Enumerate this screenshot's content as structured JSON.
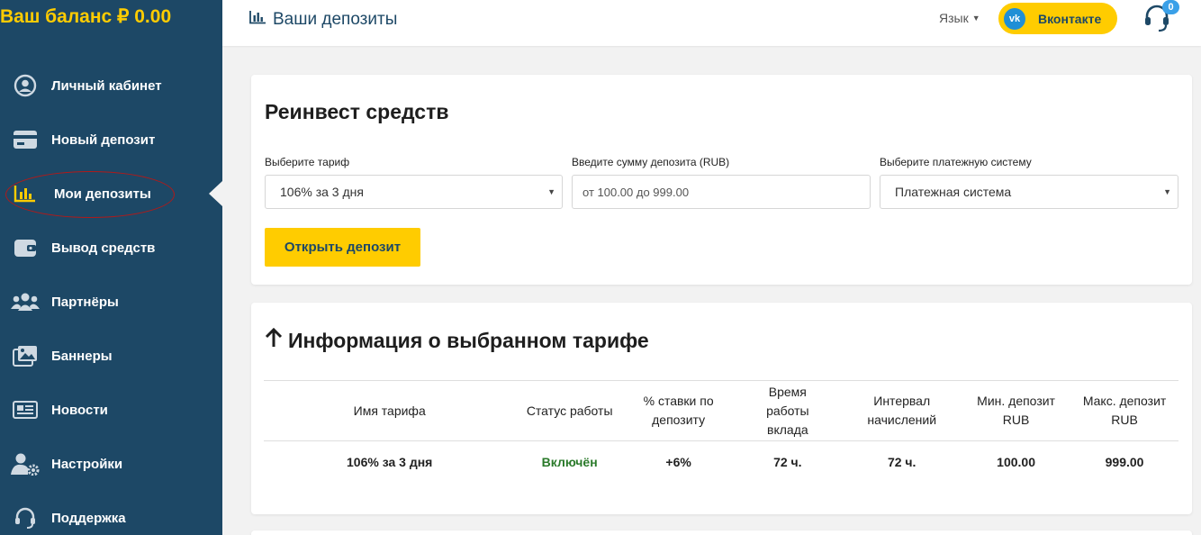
{
  "sidebar": {
    "balance": "Ваш баланс ₽ 0.00",
    "items": [
      {
        "label": "Личный кабинет",
        "icon": "user-circle-icon"
      },
      {
        "label": "Новый депозит",
        "icon": "credit-card-icon"
      },
      {
        "label": "Мои депозиты",
        "icon": "bar-chart-icon",
        "active": true
      },
      {
        "label": "Вывод средств",
        "icon": "wallet-icon"
      },
      {
        "label": "Партнёры",
        "icon": "users-icon"
      },
      {
        "label": "Баннеры",
        "icon": "images-icon"
      },
      {
        "label": "Новости",
        "icon": "newspaper-icon"
      },
      {
        "label": "Настройки",
        "icon": "user-cog-icon"
      },
      {
        "label": "Поддержка",
        "icon": "headset-icon"
      }
    ]
  },
  "header": {
    "title": "Ваши депозиты",
    "language_label": "Язык",
    "vk_label": "Вконтакте",
    "support_badge": "0"
  },
  "reinvest": {
    "title": "Реинвест средств",
    "tariff_label": "Выберите тариф",
    "tariff_value": "106% за 3 дня",
    "amount_label": "Введите сумму депозита (RUB)",
    "amount_placeholder": "от 100.00 до 999.00",
    "payment_label": "Выберите платежную систему",
    "payment_value": "Платежная система",
    "open_button": "Открыть депозит"
  },
  "tariff_info": {
    "title": "Информация о выбранном тарифе",
    "headers": [
      "Имя тарифа",
      "Статус работы",
      "% ставки по депозиту",
      "Время работы вклада",
      "Интервал начислений",
      "Мин. депозит RUB",
      "Макс. депозит RUB"
    ],
    "row": [
      "106% за 3 дня",
      "Включён",
      "+6%",
      "72 ч.",
      "72 ч.",
      "100.00",
      "999.00"
    ]
  },
  "colors": {
    "sidebar_bg": "#1d4866",
    "accent": "#ffcc00",
    "status_green": "#2a7a2a",
    "vk_blue": "#1f8fd6"
  }
}
